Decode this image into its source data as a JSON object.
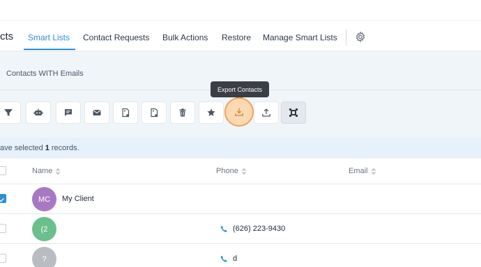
{
  "header": {
    "title": "cts"
  },
  "tabs": [
    {
      "label": "Smart Lists",
      "active": true
    },
    {
      "label": "Contact Requests",
      "active": false
    },
    {
      "label": "Bulk Actions",
      "active": false
    },
    {
      "label": "Restore",
      "active": false
    },
    {
      "label": "Manage Smart Lists",
      "active": false
    }
  ],
  "filter": {
    "smart_list_name": "Contacts WITH Emails"
  },
  "toolbar": {
    "tooltip": "Export Contacts",
    "buttons": [
      {
        "icon": "filter-icon"
      },
      {
        "icon": "robot-icon"
      },
      {
        "icon": "message-icon"
      },
      {
        "icon": "email-icon"
      },
      {
        "icon": "tag-add-icon"
      },
      {
        "icon": "tag-remove-icon"
      },
      {
        "icon": "trash-icon"
      },
      {
        "icon": "star-icon"
      },
      {
        "icon": "export-icon"
      },
      {
        "icon": "import-icon"
      },
      {
        "icon": "merge-icon"
      }
    ]
  },
  "selection": {
    "prefix": "ave selected",
    "count": "1",
    "suffix": "records."
  },
  "table": {
    "columns": [
      "Name",
      "Phone",
      "Email"
    ],
    "rows": [
      {
        "initials": "MC",
        "name": "My Client",
        "phone": "",
        "avatar_color": "#a779c4",
        "checked": true
      },
      {
        "initials": "(2",
        "name": "",
        "phone": "(626) 223-9430",
        "avatar_color": "#6bbf8c",
        "checked": false
      },
      {
        "initials": "?",
        "name": "",
        "phone": "d",
        "avatar_color": "#b9bcc1",
        "checked": false
      }
    ]
  },
  "colors": {
    "accent": "#2b8fd6",
    "highlight": "#f4a25a"
  }
}
